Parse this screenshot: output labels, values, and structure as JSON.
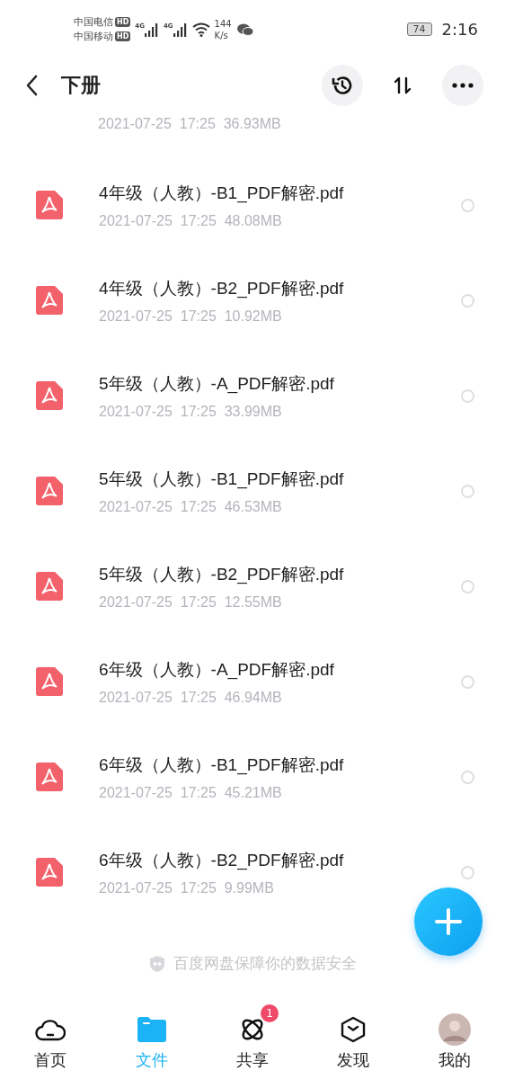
{
  "status_bar": {
    "carriers": [
      "中国电信",
      "中国移动"
    ],
    "hd": [
      "HD",
      "HD"
    ],
    "network": [
      "4G",
      "4G"
    ],
    "speed": [
      "144",
      "K/s"
    ],
    "battery": "74",
    "time": "2:16"
  },
  "header": {
    "title": "下册"
  },
  "partial_meta": "2021-07-25  17:25  36.93MB",
  "files": [
    {
      "name": "4年级（人教）-B1_PDF解密.pdf",
      "meta": "2021-07-25  17:25  48.08MB",
      "selected": false
    },
    {
      "name": "4年级（人教）-B2_PDF解密.pdf",
      "meta": "2021-07-25  17:25  10.92MB",
      "selected": false
    },
    {
      "name": "5年级（人教）-A_PDF解密.pdf",
      "meta": "2021-07-25  17:25  33.99MB",
      "selected": false
    },
    {
      "name": "5年级（人教）-B1_PDF解密.pdf",
      "meta": "2021-07-25  17:25  46.53MB",
      "selected": false
    },
    {
      "name": "5年级（人教）-B2_PDF解密.pdf",
      "meta": "2021-07-25  17:25  12.55MB",
      "selected": false
    },
    {
      "name": "6年级（人教）-A_PDF解密.pdf",
      "meta": "2021-07-25  17:25  46.94MB",
      "selected": false
    },
    {
      "name": "6年级（人教）-B1_PDF解密.pdf",
      "meta": "2021-07-25  17:25  45.21MB",
      "selected": false
    },
    {
      "name": "6年级（人教）-B2_PDF解密.pdf",
      "meta": "2021-07-25  17:25  9.99MB",
      "selected": false
    }
  ],
  "security_note": "百度网盘保障你的数据安全",
  "tabs": [
    {
      "kind": "home",
      "label": "首页",
      "selected": false
    },
    {
      "kind": "files",
      "label": "文件",
      "selected": true
    },
    {
      "kind": "share",
      "label": "共享",
      "selected": false,
      "badge": "1"
    },
    {
      "kind": "discover",
      "label": "发现",
      "selected": false
    },
    {
      "kind": "me",
      "label": "我的",
      "selected": false
    }
  ]
}
